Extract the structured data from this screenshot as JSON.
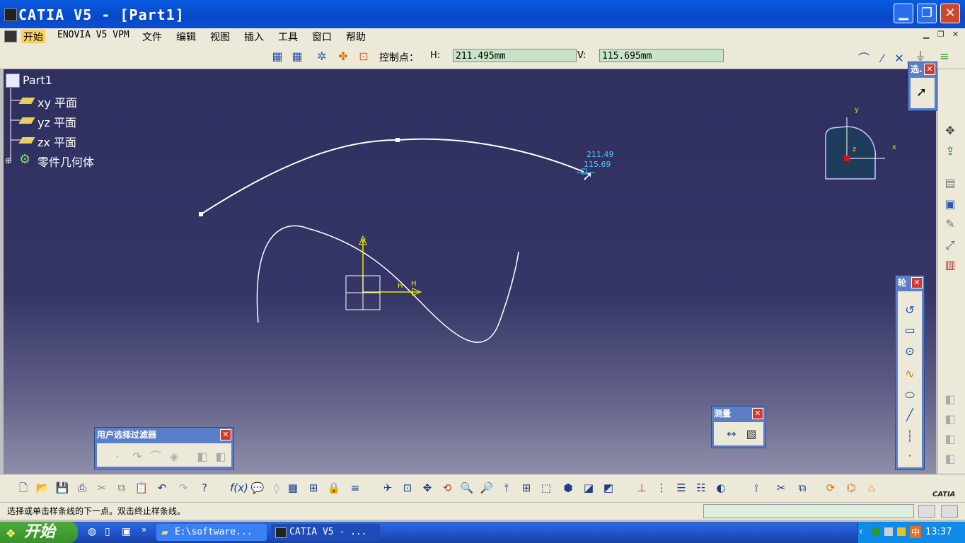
{
  "window": {
    "title": "CATIA V5 - [Part1]",
    "min_label": "▁",
    "max_label": "❐",
    "close_label": "✕"
  },
  "menu": {
    "items": [
      {
        "label": "开始"
      },
      {
        "label": "ENOVIA V5 VPM"
      },
      {
        "label": "文件"
      },
      {
        "label": "编辑"
      },
      {
        "label": "视图"
      },
      {
        "label": "插入"
      },
      {
        "label": "工具"
      },
      {
        "label": "窗口"
      },
      {
        "label": "帮助"
      }
    ]
  },
  "sketch_tools": {
    "control_point_label": "控制点：",
    "h_label": "H:",
    "h_value": "211.495mm",
    "v_label": "V:",
    "v_value": "115.695mm"
  },
  "tree": {
    "root": "Part1",
    "items": [
      {
        "label": "xy 平面"
      },
      {
        "label": "yz 平面"
      },
      {
        "label": "zx 平面"
      },
      {
        "label": "零件几何体"
      }
    ]
  },
  "viewport": {
    "cursor_h": "211.49",
    "cursor_v": "115.69",
    "axis_h": "H",
    "axis_v": "V",
    "compass_x": "x",
    "compass_y": "y",
    "compass_z": "z",
    "colors": {
      "spline": "#ffffff",
      "axis": "#e8e800",
      "dimension": "#4ec8ff",
      "compass_fill": "#1f3c5c"
    }
  },
  "panels": {
    "select_title": "选.",
    "profile_title": "轮",
    "measure_title": "测量",
    "filter_title": "用户选择过滤器"
  },
  "status": {
    "message": "选择或单击样条线的下一点。双击终止样条线。"
  },
  "taskbar": {
    "start_label": "开始",
    "tasks": [
      {
        "label": "E:\\software..."
      },
      {
        "label": "CATIA V5 - ..."
      }
    ],
    "tray_lang": "中",
    "clock": "13:37"
  },
  "brand": {
    "logo_text": "CATIA"
  }
}
